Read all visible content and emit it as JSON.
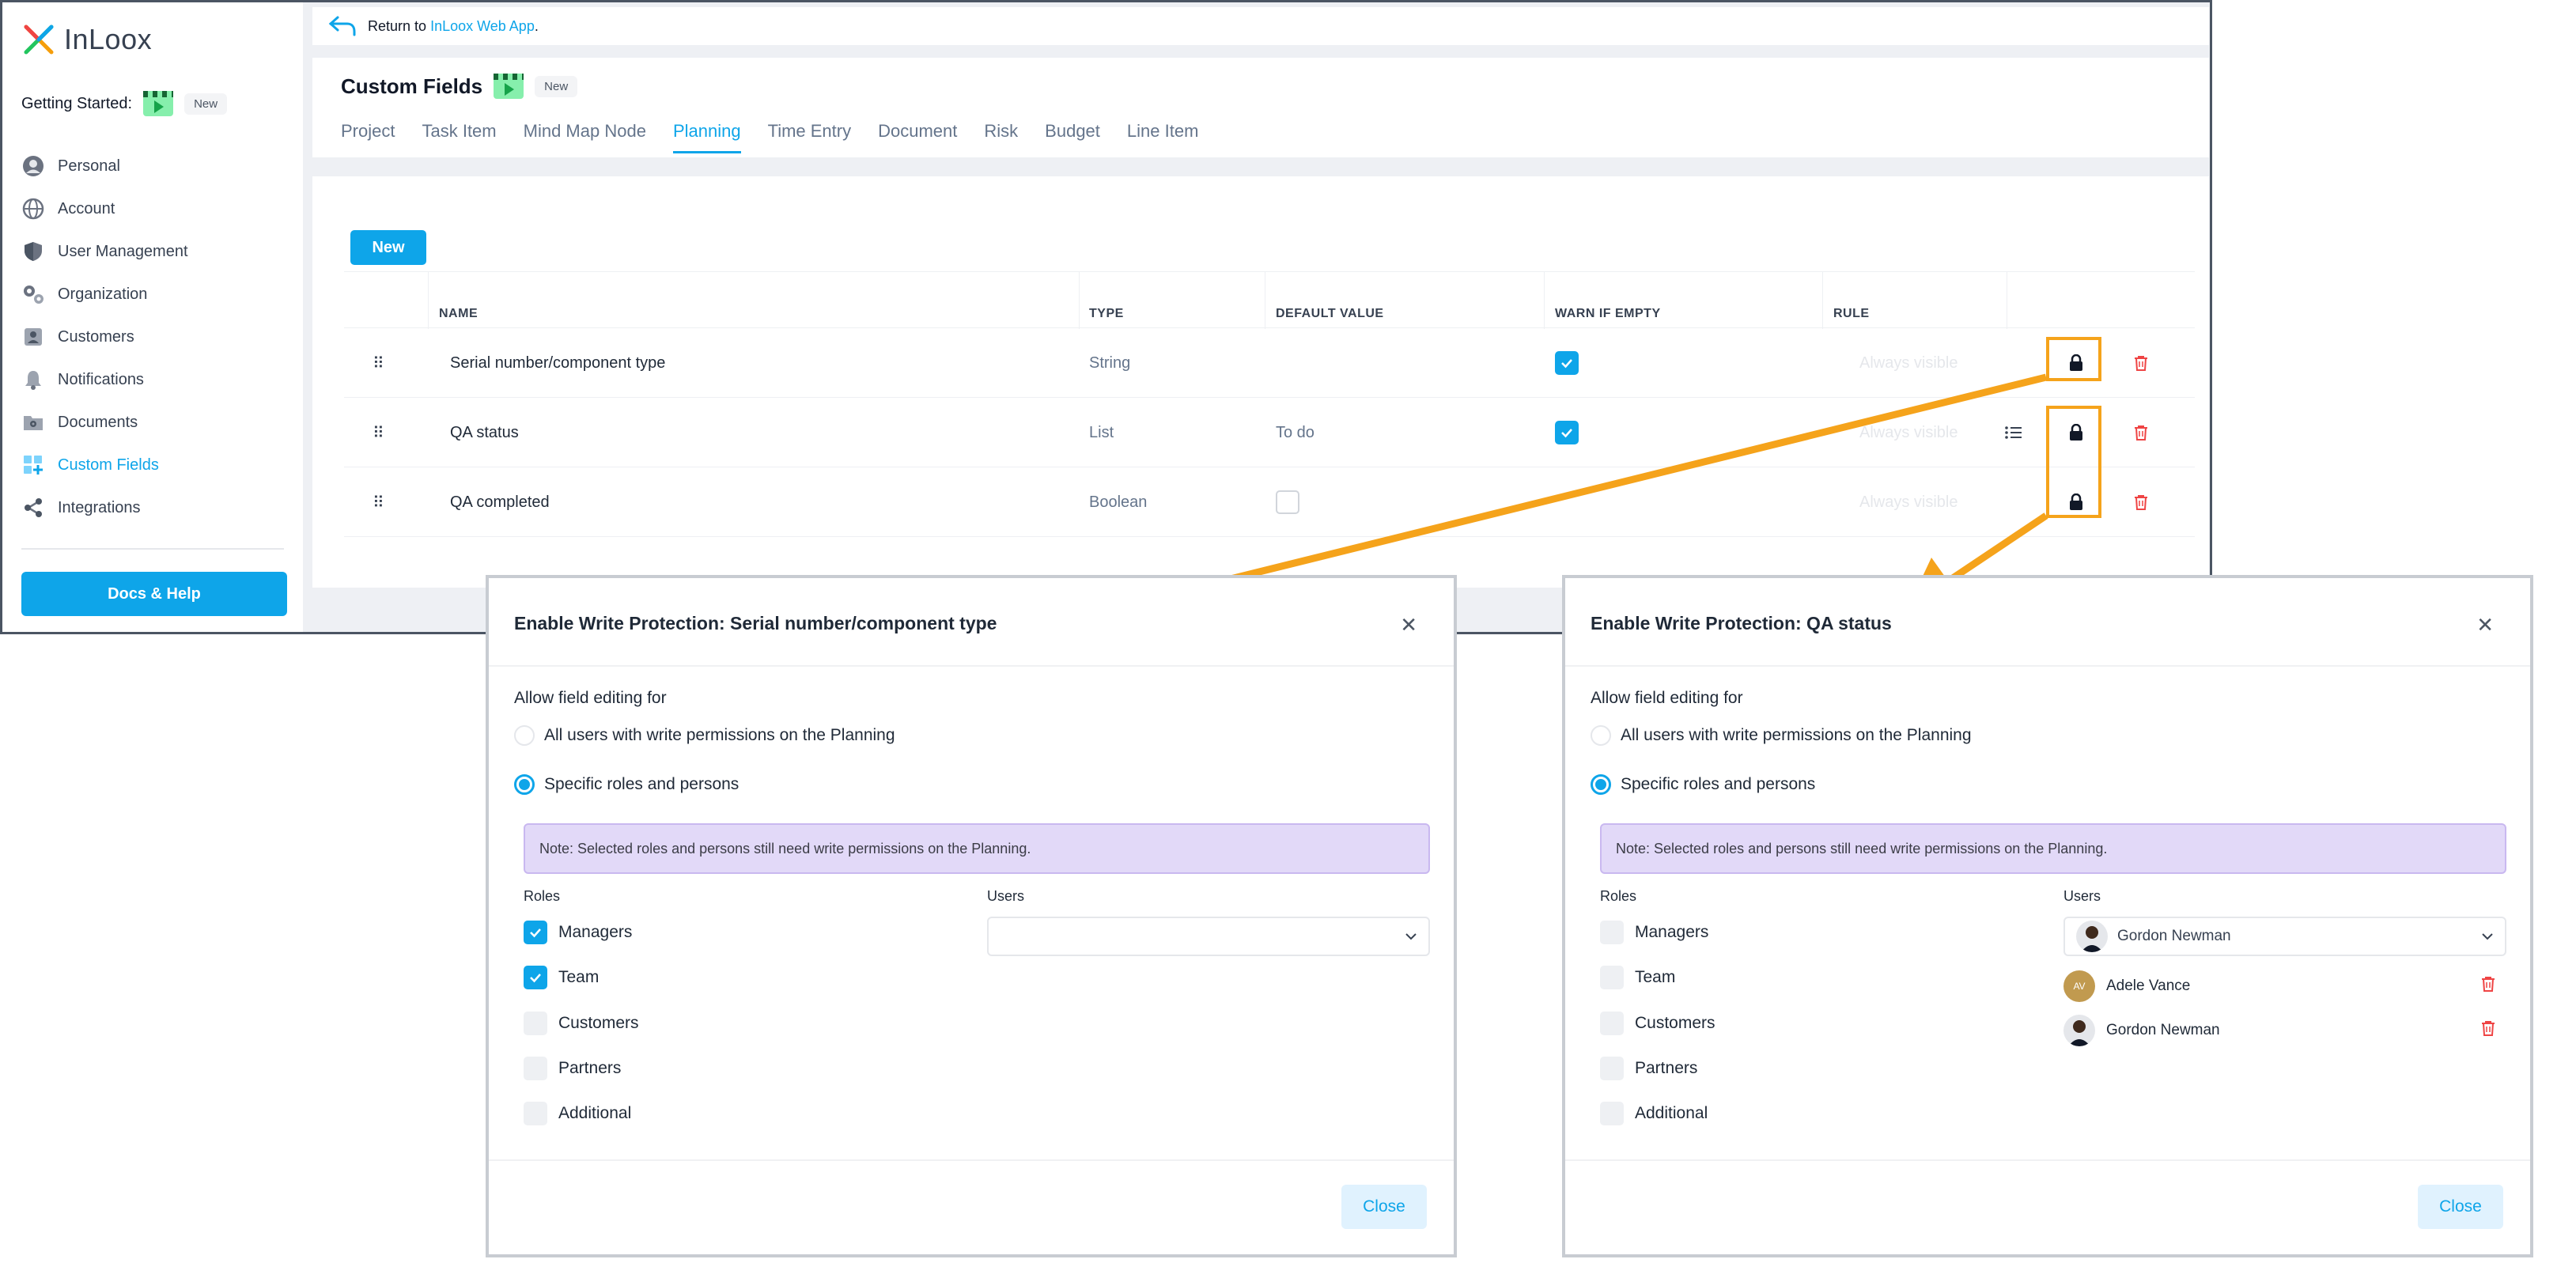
{
  "brand": {
    "name": "InLoox"
  },
  "getting_started": {
    "label": "Getting Started:",
    "badge": "New"
  },
  "sidebar": {
    "items": [
      {
        "label": "Personal",
        "icon": "user-icon"
      },
      {
        "label": "Account",
        "icon": "globe-icon"
      },
      {
        "label": "User Management",
        "icon": "shield-icon"
      },
      {
        "label": "Organization",
        "icon": "gears-icon"
      },
      {
        "label": "Customers",
        "icon": "contact-card-icon"
      },
      {
        "label": "Notifications",
        "icon": "bell-icon"
      },
      {
        "label": "Documents",
        "icon": "folder-gear-icon"
      },
      {
        "label": "Custom Fields",
        "icon": "grid-plus-icon",
        "active": true
      },
      {
        "label": "Integrations",
        "icon": "share-nodes-icon"
      }
    ],
    "docs_button": "Docs & Help"
  },
  "return_bar": {
    "prefix": "Return to",
    "link": "InLoox Web App",
    "suffix": "."
  },
  "header": {
    "title": "Custom Fields",
    "badge": "New",
    "tabs": [
      "Project",
      "Task Item",
      "Mind Map Node",
      "Planning",
      "Time Entry",
      "Document",
      "Risk",
      "Budget",
      "Line Item"
    ],
    "active_tab": "Planning"
  },
  "toolbar": {
    "new_label": "New"
  },
  "table": {
    "headers": {
      "name": "NAME",
      "type": "TYPE",
      "default": "DEFAULT VALUE",
      "warn": "WARN IF EMPTY",
      "rule": "RULE"
    },
    "rows": [
      {
        "name": "Serial number/component type",
        "type": "String",
        "default": "",
        "warn": true,
        "rule": "Always visible"
      },
      {
        "name": "QA status",
        "type": "List",
        "default": "To do",
        "warn": true,
        "rule": "Always visible"
      },
      {
        "name": "QA completed",
        "type": "Boolean",
        "default": "",
        "warn": false,
        "rule": "Always visible"
      }
    ]
  },
  "dialog_left": {
    "title": "Enable Write Protection: Serial number/component type",
    "allow_label": "Allow field editing for",
    "option_all": "All users with write permissions on the Planning",
    "option_specific": "Specific roles and persons",
    "note": "Note: Selected roles and persons still need write permissions on the Planning.",
    "roles_label": "Roles",
    "users_label": "Users",
    "roles": [
      {
        "label": "Managers",
        "checked": true
      },
      {
        "label": "Team",
        "checked": true
      },
      {
        "label": "Customers",
        "checked": false
      },
      {
        "label": "Partners",
        "checked": false
      },
      {
        "label": "Additional",
        "checked": false
      }
    ],
    "close_label": "Close"
  },
  "dialog_right": {
    "title": "Enable Write Protection: QA status",
    "allow_label": "Allow field editing for",
    "option_all": "All users with write permissions on the Planning",
    "option_specific": "Specific roles and persons",
    "note": "Note: Selected roles and persons still need write permissions on the Planning.",
    "roles_label": "Roles",
    "users_label": "Users",
    "roles": [
      {
        "label": "Managers",
        "checked": false
      },
      {
        "label": "Team",
        "checked": false
      },
      {
        "label": "Customers",
        "checked": false
      },
      {
        "label": "Partners",
        "checked": false
      },
      {
        "label": "Additional",
        "checked": false
      }
    ],
    "selected_user": "Gordon Newman",
    "users": [
      {
        "name": "Adele Vance",
        "initials": "AV"
      },
      {
        "name": "Gordon Newman",
        "initials": ""
      }
    ],
    "close_label": "Close"
  },
  "colors": {
    "accent": "#0ea5e9",
    "annotation": "#f5a31b",
    "delete": "#ef4444",
    "note_bg": "#e2d9f8"
  }
}
